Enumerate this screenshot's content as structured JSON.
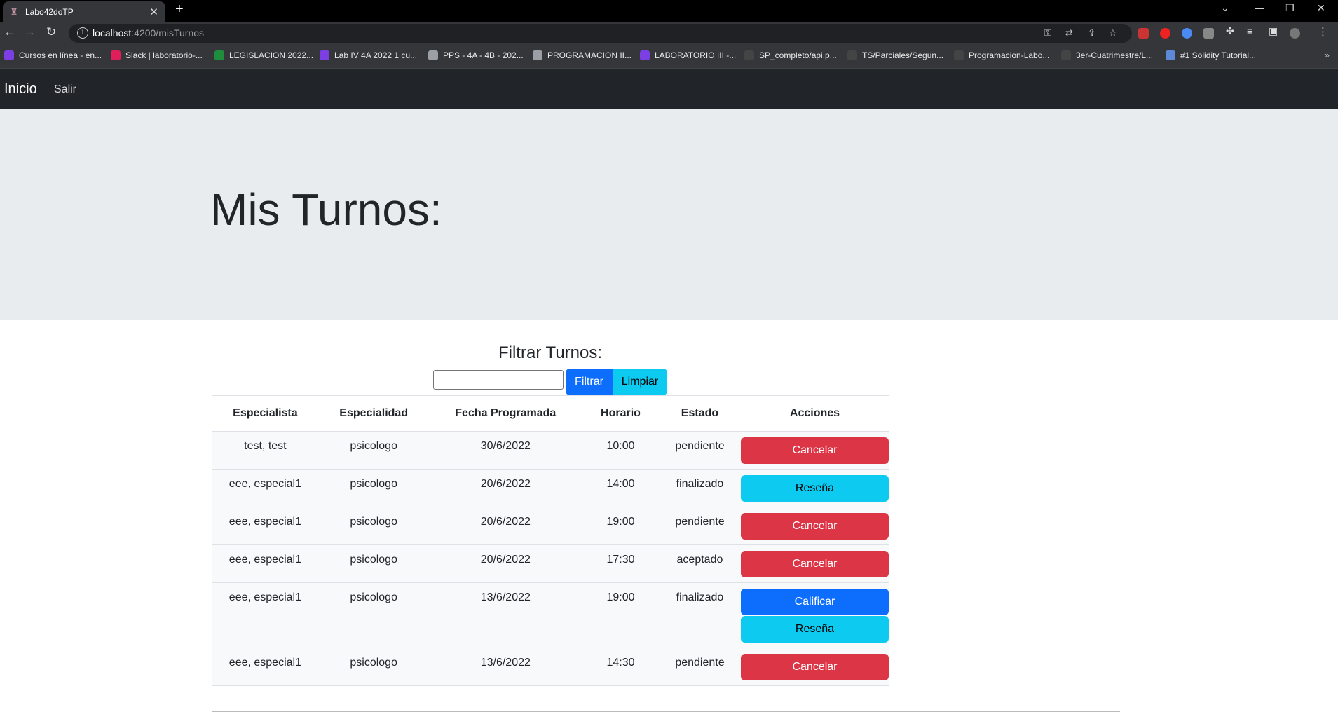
{
  "browser": {
    "tab_title": "Labo42doTP",
    "url_host": "localhost",
    "url_path": ":4200/misTurnos",
    "bookmarks": [
      {
        "label": "Cursos en línea - en...",
        "color": "#7b3fe4"
      },
      {
        "label": "Slack | laboratorio-...",
        "color": "#e01e5a"
      },
      {
        "label": "LEGISLACION 2022...",
        "color": "#1e8e3e"
      },
      {
        "label": "Lab IV 4A 2022 1 cu...",
        "color": "#7b3fe4"
      },
      {
        "label": "PPS - 4A - 4B - 202...",
        "color": "#9aa0a6"
      },
      {
        "label": "PROGRAMACION II...",
        "color": "#9aa0a6"
      },
      {
        "label": "LABORATORIO III -...",
        "color": "#7b3fe4"
      },
      {
        "label": "SP_completo/api.p...",
        "color": "#444"
      },
      {
        "label": "TS/Parciales/Segun...",
        "color": "#444"
      },
      {
        "label": "Programacion-Labo...",
        "color": "#444"
      },
      {
        "label": "3er-Cuatrimestre/L...",
        "color": "#444"
      },
      {
        "label": "#1 Solidity Tutorial...",
        "color": "#5c8ad8"
      }
    ]
  },
  "navbar": {
    "brand": "Inicio",
    "link_salir": "Salir"
  },
  "header": {
    "title": "Mis Turnos:"
  },
  "filter": {
    "title": "Filtrar Turnos:",
    "input_value": "",
    "filtrar_label": "Filtrar",
    "limpiar_label": "Limpiar"
  },
  "table": {
    "headers": [
      "Especialista",
      "Especialidad",
      "Fecha Programada",
      "Horario",
      "Estado",
      "Acciones"
    ],
    "rows": [
      {
        "especialista": "test, test",
        "especialidad": "psicologo",
        "fecha": "30/6/2022",
        "horario": "10:00",
        "estado": "pendiente",
        "acciones": [
          {
            "label": "Cancelar",
            "kind": "cancelar"
          }
        ]
      },
      {
        "especialista": "eee, especial1",
        "especialidad": "psicologo",
        "fecha": "20/6/2022",
        "horario": "14:00",
        "estado": "finalizado",
        "acciones": [
          {
            "label": "Reseña",
            "kind": "resena"
          }
        ]
      },
      {
        "especialista": "eee, especial1",
        "especialidad": "psicologo",
        "fecha": "20/6/2022",
        "horario": "19:00",
        "estado": "pendiente",
        "acciones": [
          {
            "label": "Cancelar",
            "kind": "cancelar"
          }
        ]
      },
      {
        "especialista": "eee, especial1",
        "especialidad": "psicologo",
        "fecha": "20/6/2022",
        "horario": "17:30",
        "estado": "aceptado",
        "acciones": [
          {
            "label": "Cancelar",
            "kind": "cancelar"
          }
        ]
      },
      {
        "especialista": "eee, especial1",
        "especialidad": "psicologo",
        "fecha": "13/6/2022",
        "horario": "19:00",
        "estado": "finalizado",
        "acciones": [
          {
            "label": "Calificar",
            "kind": "calificar"
          },
          {
            "label": "Reseña",
            "kind": "resena"
          }
        ]
      },
      {
        "especialista": "eee, especial1",
        "especialidad": "psicologo",
        "fecha": "13/6/2022",
        "horario": "14:30",
        "estado": "pendiente",
        "acciones": [
          {
            "label": "Cancelar",
            "kind": "cancelar"
          }
        ]
      }
    ]
  },
  "colors": {
    "primary": "#0d6efd",
    "info": "#0dcaf0",
    "danger": "#dc3545",
    "navbar": "#212529",
    "jumbotron": "#e9ecef"
  }
}
